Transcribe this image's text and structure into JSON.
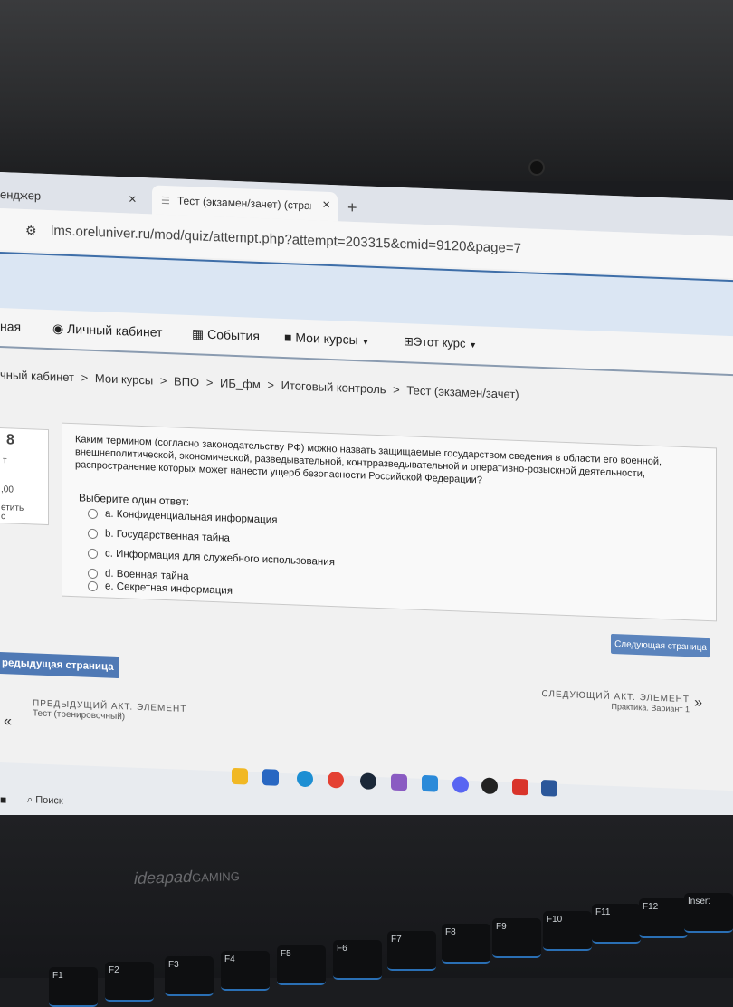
{
  "browser": {
    "tab1_title": "енджер",
    "tab2_title": "Тест (экзамен/зачет) (страниц",
    "close_glyph": "×",
    "new_tab_glyph": "+",
    "url": "lms.oreluniver.ru/mod/quiz/attempt.php?attempt=203315&cmid=9120&page=7"
  },
  "nav": {
    "home_partial": "ная",
    "cabinet": "Личный кабинет",
    "events": "События",
    "my_courses": "Мои курсы",
    "this_course": "Этот курс"
  },
  "breadcrumbs": [
    "чный кабинет",
    "Мои курсы",
    "ВПО",
    "ИБ_фм",
    "Итоговый контроль",
    "Тест (экзамен/зачет)"
  ],
  "breadcrumb_sep": ">",
  "side": {
    "number": "8",
    "t": "т",
    "score": ",00",
    "flag": "етить",
    "c": "с"
  },
  "question": {
    "text": "Каким термином (согласно законодательству РФ) можно назвать защищаемые государством сведения в области его военной, внешнеполитической, экономической, разведывательной, контрразведывательной и оперативно-розыскной деятельности, распространение которых может нанести ущерб безопасности Российской Федерации?",
    "prompt": "Выберите один ответ:",
    "options": [
      "a. Конфиденциальная информация",
      "b. Государственная тайна",
      "c. Информация для служебного использования",
      "d. Военная тайна",
      "e. Секретная информация"
    ]
  },
  "buttons": {
    "next_page": "Следующая страница",
    "prev_page": "редыдущая страница"
  },
  "next_activity": {
    "heading": "СЛЕДУЮЩИЙ АКТ. ЭЛЕМЕНТ",
    "name": "Практика. Вариант 1",
    "arrow": "»"
  },
  "prev_activity": {
    "heading": "ПРЕДЫДУЩИЙ АКТ. ЭЛЕМЕНТ",
    "name": "Тест (тренировочный)",
    "arrow": "«"
  },
  "taskbar": {
    "search": "Поиск"
  },
  "laptop": {
    "brand": "ideapad",
    "brand_suffix": "GAMING"
  },
  "keys": [
    "F1",
    "F2",
    "F3",
    "F4",
    "F5",
    "F6",
    "F7",
    "F8",
    "F9",
    "F10",
    "F11",
    "F12",
    "Insert"
  ]
}
